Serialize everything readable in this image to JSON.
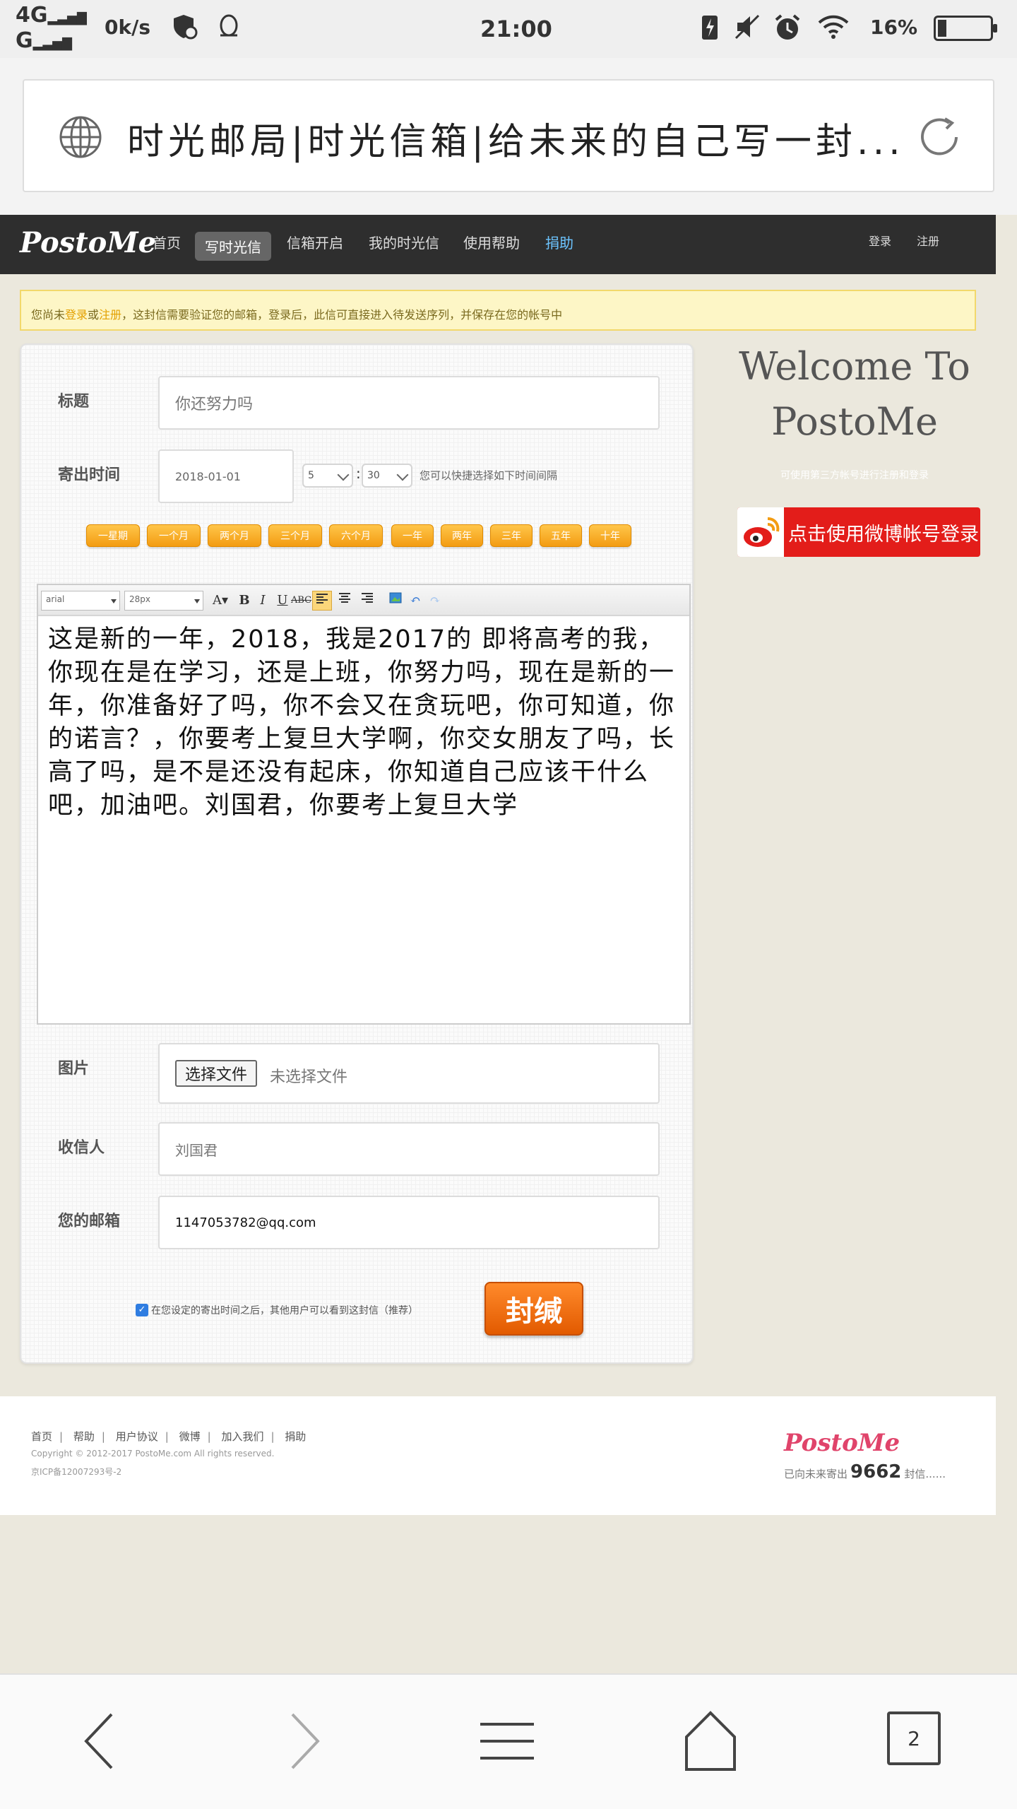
{
  "status_bar": {
    "network_top": "4G",
    "network_bottom": "G",
    "speed": "0k/s",
    "time": "21:00",
    "battery_percent": "16%",
    "battery_level": 0.16
  },
  "url_bar": {
    "title": "时光邮局|时光信箱|给未来的自己写一封..."
  },
  "nav": {
    "logo": "PostoMe",
    "items": [
      "首页",
      "写时光信",
      "信箱开启",
      "我的时光信",
      "使用帮助",
      "捐助"
    ],
    "login": "登录",
    "register": "注册"
  },
  "notice": {
    "pre": "您尚未",
    "login": "登录",
    "or": "或",
    "register": "注册",
    "rest": "，这封信需要验证您的邮箱，登录后，此信可直接进入待发送序列，并保存在您的帐号中"
  },
  "form": {
    "title_label": "标题",
    "title_value": "你还努力吗",
    "send_time_label": "寄出时间",
    "date_value": "2018-01-01",
    "hour_value": "5",
    "minute_value": "30",
    "quick_hint": "您可以快捷选择如下时间间隔",
    "quick_buttons": [
      "一星期",
      "一个月",
      "两个月",
      "三个月",
      "六个月",
      "一年",
      "两年",
      "三年",
      "五年",
      "十年"
    ],
    "font_family": "arial",
    "font_size": "28px",
    "body": "这是新的一年，2018，我是2017的 即将高考的我，你现在是在学习，还是上班，你努力吗，现在是新的一年，你准备好了吗，你不会又在贪玩吧，你可知道，你的诺言？，你要考上复旦大学啊，你交女朋友了吗，长高了吗，是不是还没有起床，你知道自己应该干什么吧，加油吧。刘国君，你要考上复旦大学",
    "image_label": "图片",
    "file_button": "选择文件",
    "file_status": "未选择文件",
    "recipient_label": "收信人",
    "recipient_value": "刘国君",
    "email_label": "您的邮箱",
    "email_value": "1147053782@qq.com",
    "consent_text": "在您设定的寄出时间之后，其他用户可以看到这封信（推荐）",
    "submit": "封缄"
  },
  "sidebar": {
    "welcome": "Welcome To PostoMe",
    "hint": "可使用第三方帐号进行注册和登录",
    "weibo_button": "点击使用微博帐号登录"
  },
  "footer": {
    "links": [
      "首页",
      "帮助",
      "用户协议",
      "微博",
      "加入我们",
      "捐助"
    ],
    "copyright": "Copyright © 2012-2017 PostoMe.com All rights reserved.",
    "icp": "京ICP备12007293号-2",
    "logo": "PostoMe",
    "count_prefix": "已向未来寄出",
    "count": "9662",
    "count_suffix": "封信......"
  },
  "bottom_bar": {
    "tabs_count": "2"
  },
  "colors": {
    "nav_bg": "#2e2e2e",
    "accent_orange": "#f39c12",
    "seal_orange": "#e25a00",
    "weibo_red": "#e31d1a",
    "page_bg": "#ebe8dd"
  }
}
